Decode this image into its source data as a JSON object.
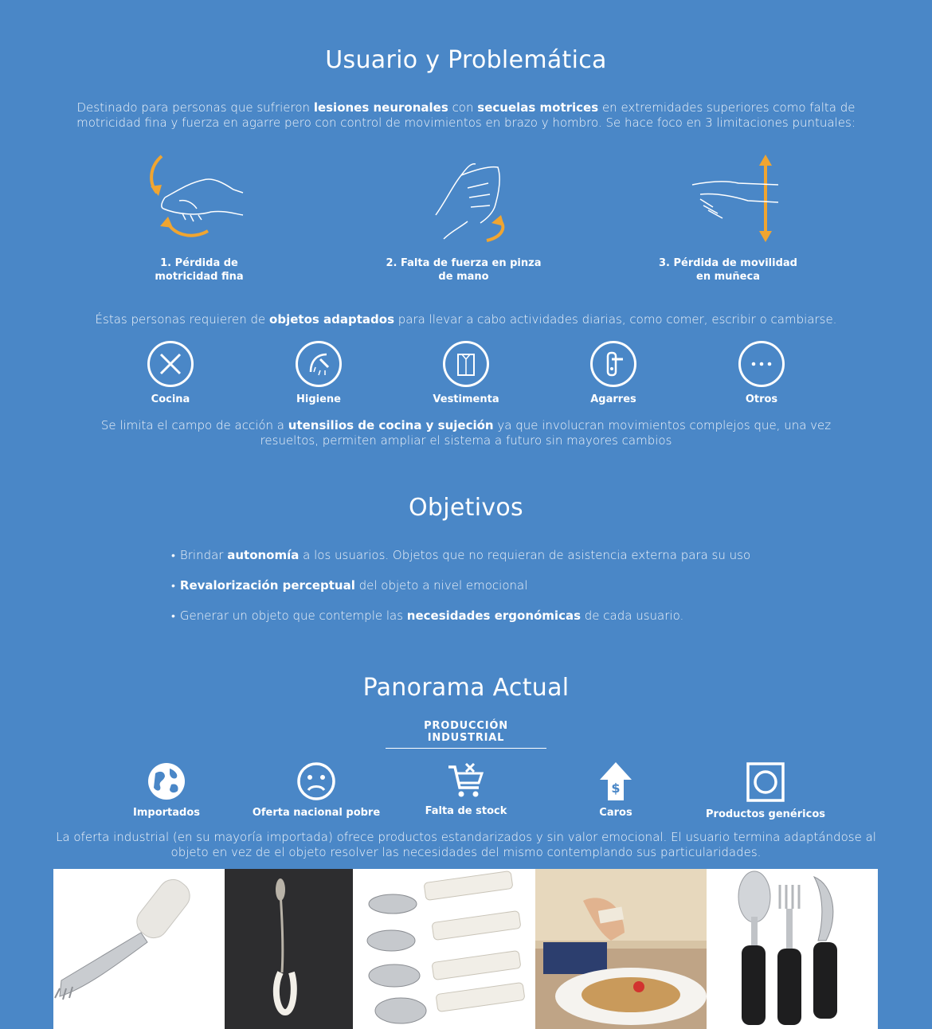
{
  "section1": {
    "title": "Usuario y Problemática",
    "intro": {
      "t1": "Destinado para personas que sufrieron ",
      "b1": "lesiones neuronales",
      "t2": " con ",
      "b2": "secuelas motrices",
      "t3": " en extremidades superiores como falta de motricidad fina y fuerza en agarre pero con control de movimientos en brazo y hombro. Se hace foco en 3 limitaciones puntuales:"
    },
    "limitations": [
      {
        "line1": "1. Pérdida de",
        "line2": "motricidad fina"
      },
      {
        "line1": "2. Falta de fuerza en pinza",
        "line2": "de mano"
      },
      {
        "line1": "3. Pérdida de movilidad",
        "line2": "en muñeca"
      }
    ],
    "need": {
      "t1": "Éstas personas requieren de ",
      "b1": "objetos adaptados",
      "t2": " para llevar a cabo actividades diarias, como comer, escribir o cambiarse."
    },
    "categories": [
      {
        "label": "Cocina",
        "icon": "cutlery-icon"
      },
      {
        "label": "Higiene",
        "icon": "shower-icon"
      },
      {
        "label": "Vestimenta",
        "icon": "shirt-icon"
      },
      {
        "label": "Agarres",
        "icon": "door-handle-icon"
      },
      {
        "label": "Otros",
        "icon": "more-icon"
      }
    ],
    "scope": {
      "t1": "Se limita el campo de acción a ",
      "b1": "utensilios de cocina y sujeción",
      "t2": " ya que involucran movimientos complejos que, una vez resueltos, permiten ampliar el sistema a futuro sin mayores cambios"
    }
  },
  "section2": {
    "title": "Objetivos",
    "bullets": [
      {
        "pre": "Brindar ",
        "bold": "autonomía",
        "post": " a los usuarios. Objetos que no requieran de asistencia externa para su uso"
      },
      {
        "pre": "",
        "bold": "Revalorización perceptual",
        "post": " del objeto a nivel emocional"
      },
      {
        "pre": "Generar un objeto que contemple las ",
        "bold": "necesidades ergonómicas",
        "post": " de cada usuario."
      }
    ]
  },
  "section3": {
    "title": "Panorama Actual",
    "subtitle": "PRODUCCIÓN INDUSTRIAL",
    "issues": [
      {
        "label": "Importados",
        "icon": "globe-icon"
      },
      {
        "label": "Oferta nacional pobre",
        "icon": "sad-face-icon"
      },
      {
        "label": "Falta de stock",
        "icon": "cart-x-icon"
      },
      {
        "label": "Caros",
        "icon": "price-up-icon"
      },
      {
        "label": "Productos genéricos",
        "icon": "generic-product-icon"
      }
    ],
    "summary": "La oferta industrial (en su mayoría importada) ofrece productos estandarizados y sin valor emocional. El usuario termina adaptándose al objeto en vez de el objeto resolver las necesidades del mismo contemplando sus particularidades."
  },
  "colors": {
    "background": "#4a87c7",
    "accent_arrow": "#f0a531",
    "text": "#ffffff"
  }
}
